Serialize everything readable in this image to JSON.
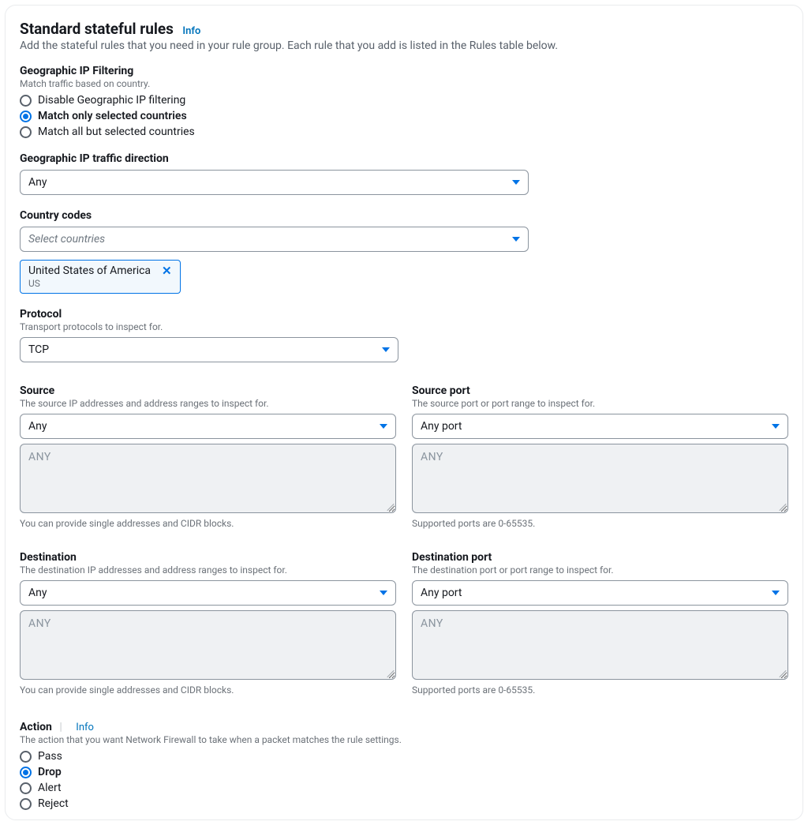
{
  "header": {
    "title": "Standard stateful rules",
    "info": "Info",
    "subtitle": "Add the stateful rules that you need in your rule group. Each rule that you add is listed in the Rules table below."
  },
  "geo_filter": {
    "label": "Geographic IP Filtering",
    "help": "Match traffic based on country.",
    "options": [
      "Disable Geographic IP filtering",
      "Match only selected countries",
      "Match all but selected countries"
    ],
    "selected_index": 1
  },
  "geo_direction": {
    "label": "Geographic IP traffic direction",
    "value": "Any"
  },
  "country_codes": {
    "label": "Country codes",
    "placeholder": "Select countries",
    "selected": {
      "name": "United States of America",
      "code": "US"
    }
  },
  "protocol": {
    "label": "Protocol",
    "help": "Transport protocols to inspect for.",
    "value": "TCP"
  },
  "source": {
    "label": "Source",
    "help": "The source IP addresses and address ranges to inspect for.",
    "value": "Any",
    "textarea_ph": "ANY",
    "hint": "You can provide single addresses and CIDR blocks."
  },
  "source_port": {
    "label": "Source port",
    "help": "The source port or port range to inspect for.",
    "value": "Any port",
    "textarea_ph": "ANY",
    "hint": "Supported ports are 0-65535."
  },
  "destination": {
    "label": "Destination",
    "help": "The destination IP addresses and address ranges to inspect for.",
    "value": "Any",
    "textarea_ph": "ANY",
    "hint": "You can provide single addresses and CIDR blocks."
  },
  "destination_port": {
    "label": "Destination port",
    "help": "The destination port or port range to inspect for.",
    "value": "Any port",
    "textarea_ph": "ANY",
    "hint": "Supported ports are 0-65535."
  },
  "action": {
    "label": "Action",
    "info": "Info",
    "help": "The action that you want Network Firewall to take when a packet matches the rule settings.",
    "options": [
      "Pass",
      "Drop",
      "Alert",
      "Reject"
    ],
    "selected_index": 1
  }
}
